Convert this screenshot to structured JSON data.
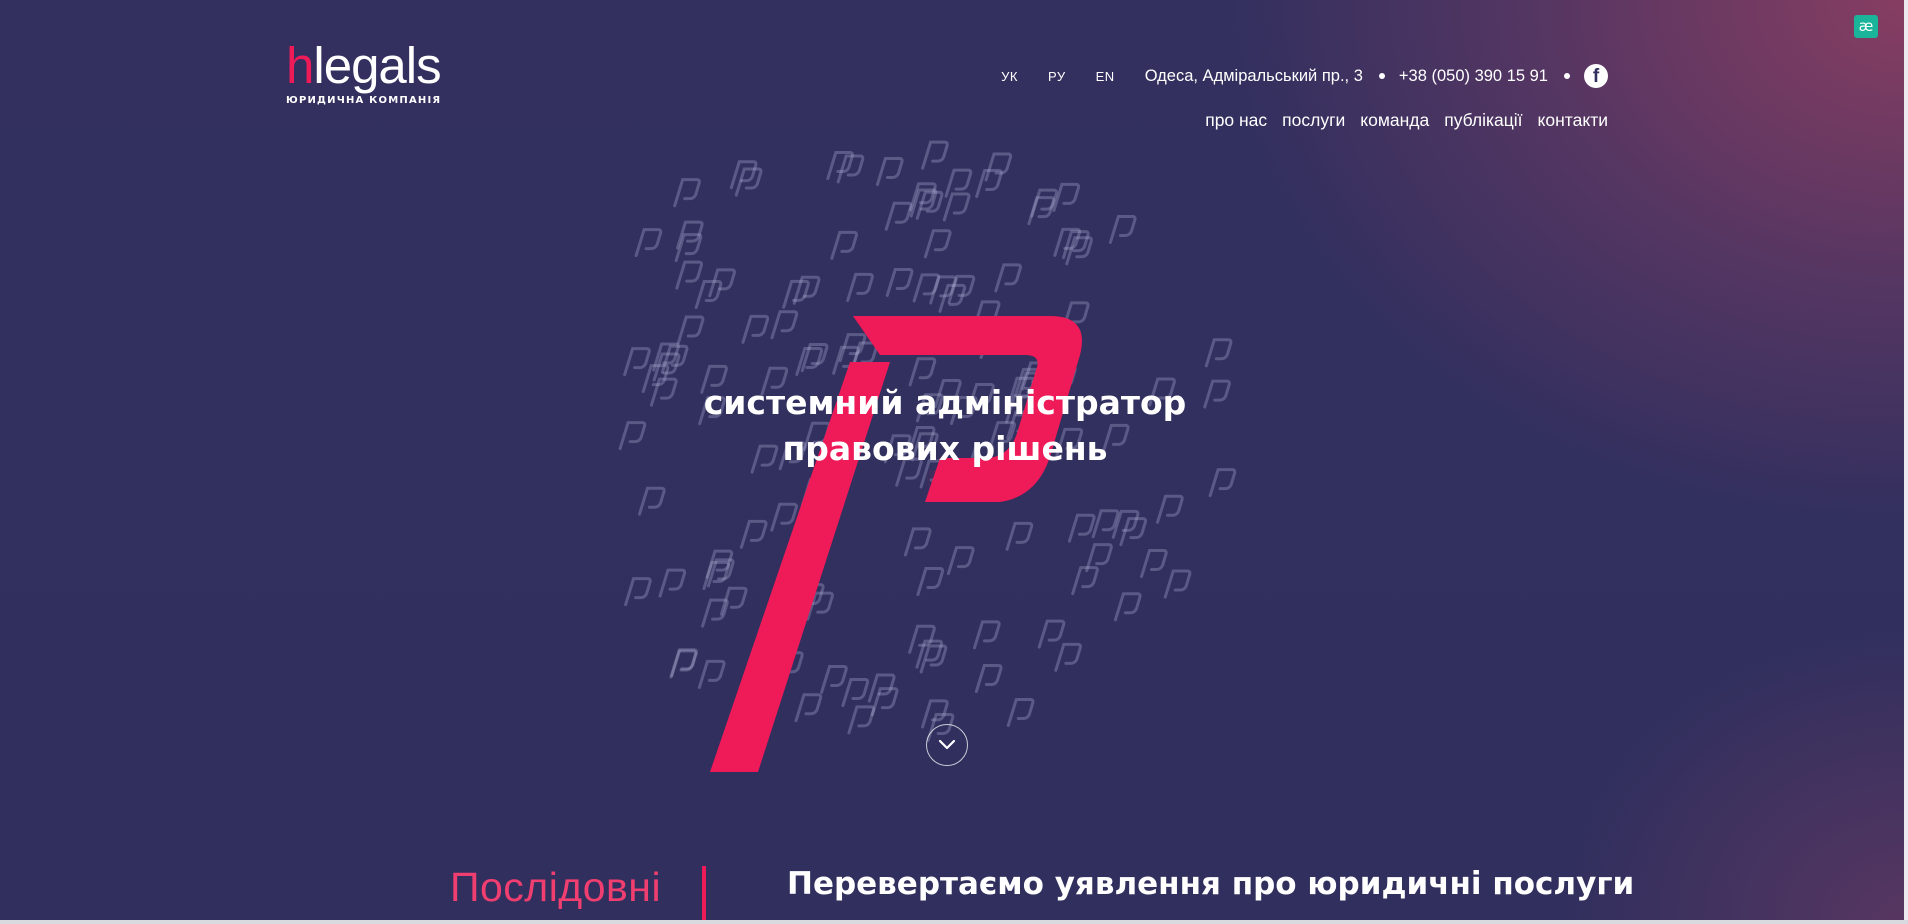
{
  "logo": {
    "mark": "h",
    "word": "legals",
    "subtitle": "ЮРИДИЧНА КОМПАНІЯ"
  },
  "languages": [
    "УК",
    "РУ",
    "EN"
  ],
  "contacts": {
    "address": "Одеса, Адміральський пр., 3",
    "phone": "+38 (050) 390 15 91"
  },
  "social_icon": "facebook-icon",
  "nav": [
    "про нас",
    "послуги",
    "команда",
    "публікації",
    "контакти"
  ],
  "hero": {
    "line1": "системний адміністратор",
    "line2": "правових рішень"
  },
  "scroll_icon": "chevron-down-icon",
  "section": {
    "left_label": "Послідовні",
    "heading": "Перевертаємо уявлення про юридичні послуги"
  },
  "extension_icon": "æ",
  "colors": {
    "accent": "#ef1a58",
    "background": "#31305f",
    "gradient_corner": "#8c3e62"
  }
}
